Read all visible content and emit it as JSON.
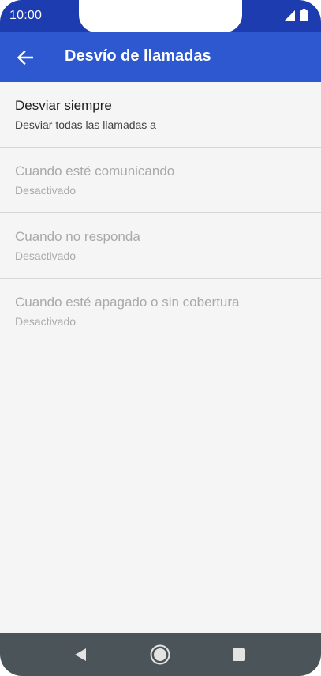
{
  "status_bar": {
    "time": "10:00",
    "signal_icon": "signal-icon",
    "battery_icon": "battery-icon"
  },
  "app_bar": {
    "back_icon": "arrow-left-icon",
    "title": "Desvío de llamadas"
  },
  "list": {
    "items": [
      {
        "title": "Desviar siempre",
        "subtitle": "Desviar todas las llamadas a",
        "enabled": true
      },
      {
        "title": "Cuando esté comunicando",
        "subtitle": "Desactivado",
        "enabled": false
      },
      {
        "title": "Cuando no responda",
        "subtitle": "Desactivado",
        "enabled": false
      },
      {
        "title": "Cuando esté apagado o sin cobertura",
        "subtitle": "Desactivado",
        "enabled": false
      }
    ]
  },
  "nav_bar": {
    "back_icon": "triangle-back-icon",
    "home_icon": "circle-home-icon",
    "recents_icon": "square-recents-icon"
  },
  "colors": {
    "status_bar": "#1c3cb0",
    "app_bar": "#2d58cf",
    "background": "#f5f5f5",
    "nav_bar": "#4b5458",
    "disabled_text": "#a9a9a9"
  }
}
